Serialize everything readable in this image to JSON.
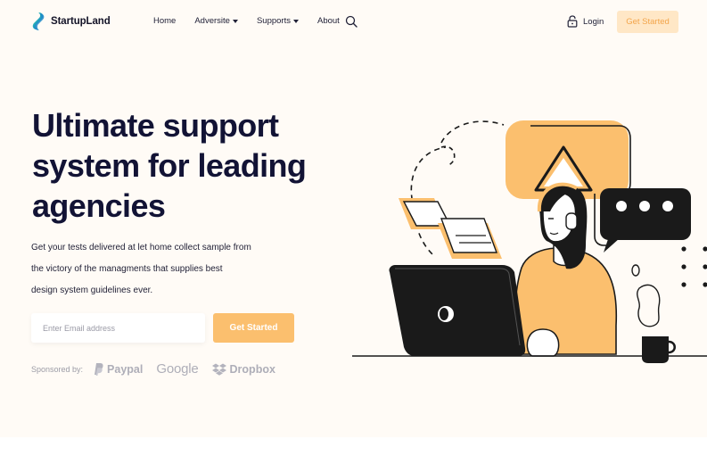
{
  "brand": {
    "name": "StartupLand"
  },
  "nav": {
    "links": [
      {
        "label": "Home",
        "has_dropdown": false
      },
      {
        "label": "Adversite",
        "has_dropdown": true
      },
      {
        "label": "Supports",
        "has_dropdown": true
      },
      {
        "label": "About",
        "has_dropdown": false
      }
    ],
    "search_icon": "search-icon",
    "login_icon": "lock-icon",
    "login_label": "Login",
    "cta_label": "Get Started"
  },
  "hero": {
    "title_lines": [
      "Ultimate support",
      "system for leading",
      "agencies"
    ],
    "description_lines": [
      "Get your tests delivered at let home collect sample from",
      "the victory of the managments that supplies best",
      "design system guidelines ever."
    ],
    "email_placeholder": "Enter Email address",
    "cta_label": "Get Started"
  },
  "sponsors": {
    "label": "Sponsored by:",
    "items": [
      {
        "name": "Paypal",
        "icon": "paypal-icon"
      },
      {
        "name": "Google",
        "icon": ""
      },
      {
        "name": "Dropbox",
        "icon": "dropbox-icon"
      }
    ]
  },
  "colors": {
    "accent": "#fbbf6e",
    "accent_light": "#ffe7c6",
    "accent_text": "#f3a54b",
    "heading": "#121335",
    "background": "#fffbf6"
  }
}
